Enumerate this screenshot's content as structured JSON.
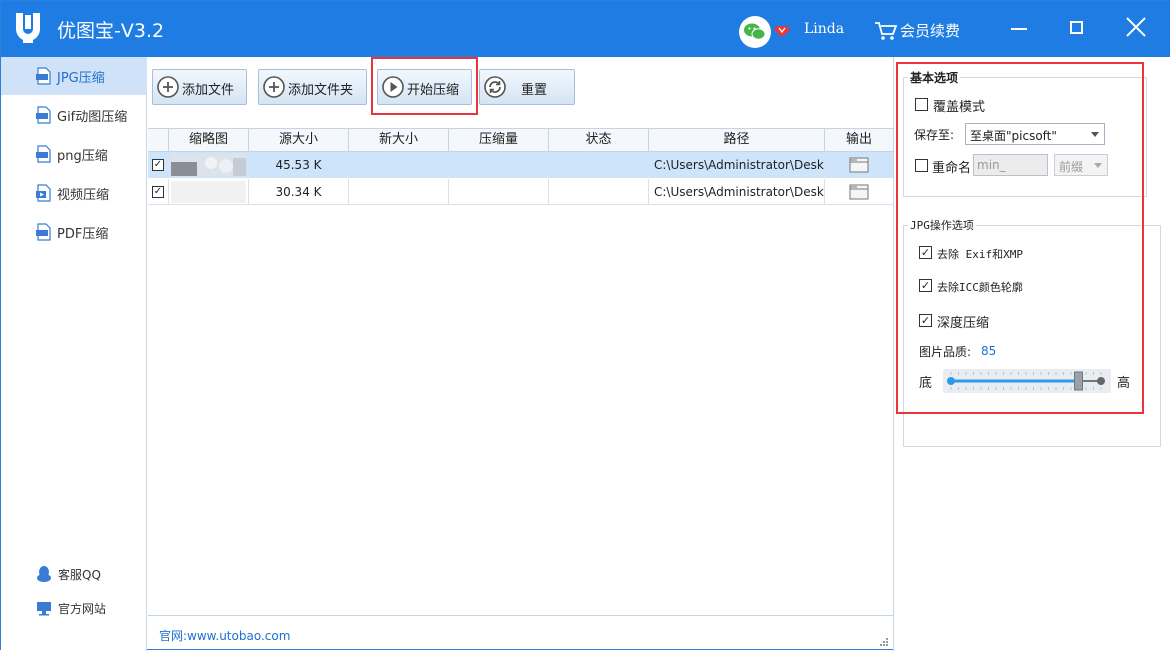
{
  "app": {
    "title": "优图宝-V3.2"
  },
  "user": {
    "name": "Linda",
    "renew_label": "会员续费"
  },
  "sidebar": {
    "items": [
      {
        "label": "JPG压缩",
        "icon": "jpg-file-icon",
        "active": true
      },
      {
        "label": "Gif动图压缩",
        "icon": "gif-file-icon",
        "active": false
      },
      {
        "label": "png压缩",
        "icon": "png-file-icon",
        "active": false
      },
      {
        "label": "视频压缩",
        "icon": "video-file-icon",
        "active": false
      },
      {
        "label": "PDF压缩",
        "icon": "pdf-file-icon",
        "active": false
      }
    ],
    "support_label": "客服QQ",
    "website_label": "官方网站"
  },
  "toolbar": {
    "add_file": "添加文件",
    "add_folder": "添加文件夹",
    "start": "开始压缩",
    "reset": "重置"
  },
  "table": {
    "columns": [
      "缩略图",
      "源大小",
      "新大小",
      "压缩量",
      "状态",
      "路径",
      "输出"
    ],
    "rows": [
      {
        "checked": true,
        "source_size": "45.53 K",
        "new_size": "",
        "saved": "",
        "status": "",
        "path": "C:\\Users\\Administrator\\Desk..."
      },
      {
        "checked": true,
        "source_size": "30.34 K",
        "new_size": "",
        "saved": "",
        "status": "",
        "path": "C:\\Users\\Administrator\\Desk..."
      }
    ]
  },
  "status": {
    "site": "官网:www.utobao.com"
  },
  "options": {
    "basic_title": "基本选项",
    "overwrite_label": "覆盖模式",
    "overwrite_checked": false,
    "save_to_label": "保存至:",
    "save_to_value": "至桌面\"picsoft\"",
    "rename_label": "重命名",
    "rename_checked": false,
    "rename_placeholder": "min_",
    "rename_position": "前缀",
    "jpg_title": "JPG操作选项",
    "remove_exif": "去除 Exif和XMP",
    "remove_exif_checked": true,
    "remove_icc": "去除ICC颜色轮廓",
    "remove_icc_checked": true,
    "deep_compress": "深度压缩",
    "deep_compress_checked": true,
    "quality_label": "图片品质:",
    "quality_value": "85",
    "quality_fraction": 0.85,
    "low_label": "底",
    "high_label": "高"
  },
  "colors": {
    "titlebar": "#1e7ce3",
    "highlight_frame": "#e8363b",
    "selected_row": "#cde4fb"
  }
}
